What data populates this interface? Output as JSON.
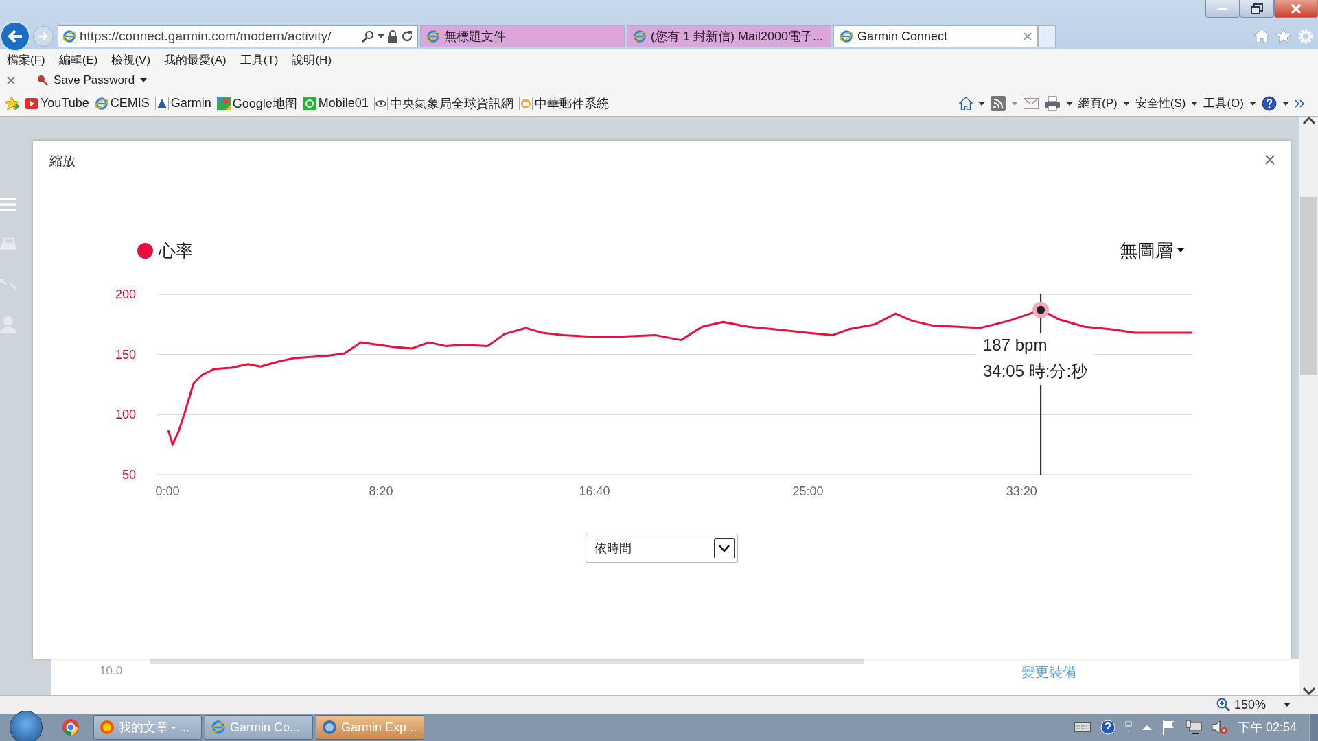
{
  "browser": {
    "address": "https://connect.garmin.com/modern/activity/",
    "tabs": [
      {
        "title": "無標題文件",
        "selected": false
      },
      {
        "title": "(您有 1 封新信) Mail2000電子...",
        "selected": false
      },
      {
        "title": "Garmin Connect",
        "selected": true
      }
    ],
    "menu": [
      "檔案(F)",
      "編輯(E)",
      "檢視(V)",
      "我的最愛(A)",
      "工具(T)",
      "說明(H)"
    ],
    "save_password": "Save Password",
    "favorites": [
      "YouTube",
      "CEMIS",
      "Garmin",
      "Google地图",
      "Mobile01",
      "中央氣象局全球資訊網",
      "中華郵件系統"
    ],
    "command_bar": [
      "網頁(P)",
      "安全性(S)",
      "工具(O)"
    ],
    "zoom": "150%"
  },
  "page": {
    "axis_label": "10.0",
    "link": "變更裝備"
  },
  "modal": {
    "title": "縮放",
    "layers": "無圖層",
    "tooltip": {
      "value": "187 bpm",
      "time": "34:05 時:分:秒"
    },
    "chart_data": {
      "type": "line",
      "xlim": [
        -24,
        2400
      ],
      "ylim": [
        50,
        200
      ],
      "xticks": [
        {
          "value": 0,
          "label": "0:00"
        },
        {
          "value": 500,
          "label": "8:20"
        },
        {
          "value": 1000,
          "label": "16:40"
        },
        {
          "value": 1500,
          "label": "25:00"
        },
        {
          "value": 2000,
          "label": "33:20"
        }
      ],
      "yticks": [
        50,
        100,
        150,
        200
      ],
      "x": [
        2,
        12,
        26,
        41,
        61,
        81,
        110,
        150,
        189,
        218,
        258,
        297,
        336,
        376,
        415,
        453,
        492,
        533,
        573,
        612,
        652,
        691,
        750,
        789,
        839,
        878,
        927,
        986,
        1065,
        1144,
        1203,
        1252,
        1301,
        1360,
        1419,
        1498,
        1557,
        1596,
        1656,
        1705,
        1744,
        1793,
        1852,
        1902,
        1970,
        2045,
        2089,
        2148,
        2207,
        2266,
        2325,
        2400
      ],
      "series": [
        {
          "name": "心率",
          "color": "#e8103c",
          "values": [
            87,
            75,
            86,
            102,
            126,
            133,
            138,
            139,
            142,
            140,
            144,
            147,
            148,
            149,
            151,
            160,
            158,
            156,
            155,
            160,
            157,
            158,
            157,
            167,
            172,
            168,
            166,
            165,
            165,
            166,
            162,
            173,
            177,
            173,
            171,
            168,
            166,
            171,
            175,
            184,
            178,
            174,
            173,
            172,
            178,
            187,
            179,
            173,
            171,
            168,
            168,
            168
          ]
        }
      ],
      "ref_lines": [
        {
          "axis": "x",
          "value": 2045,
          "color": "#111111"
        }
      ]
    },
    "select": {
      "value": "依時間"
    }
  },
  "taskbar": {
    "items": [
      {
        "label": "我的文章 - ...",
        "selected": false
      },
      {
        "label": "Garmin Co...",
        "selected": false
      },
      {
        "label": "Garmin Exp...",
        "selected": true
      }
    ],
    "clock": "下午 02:54"
  }
}
